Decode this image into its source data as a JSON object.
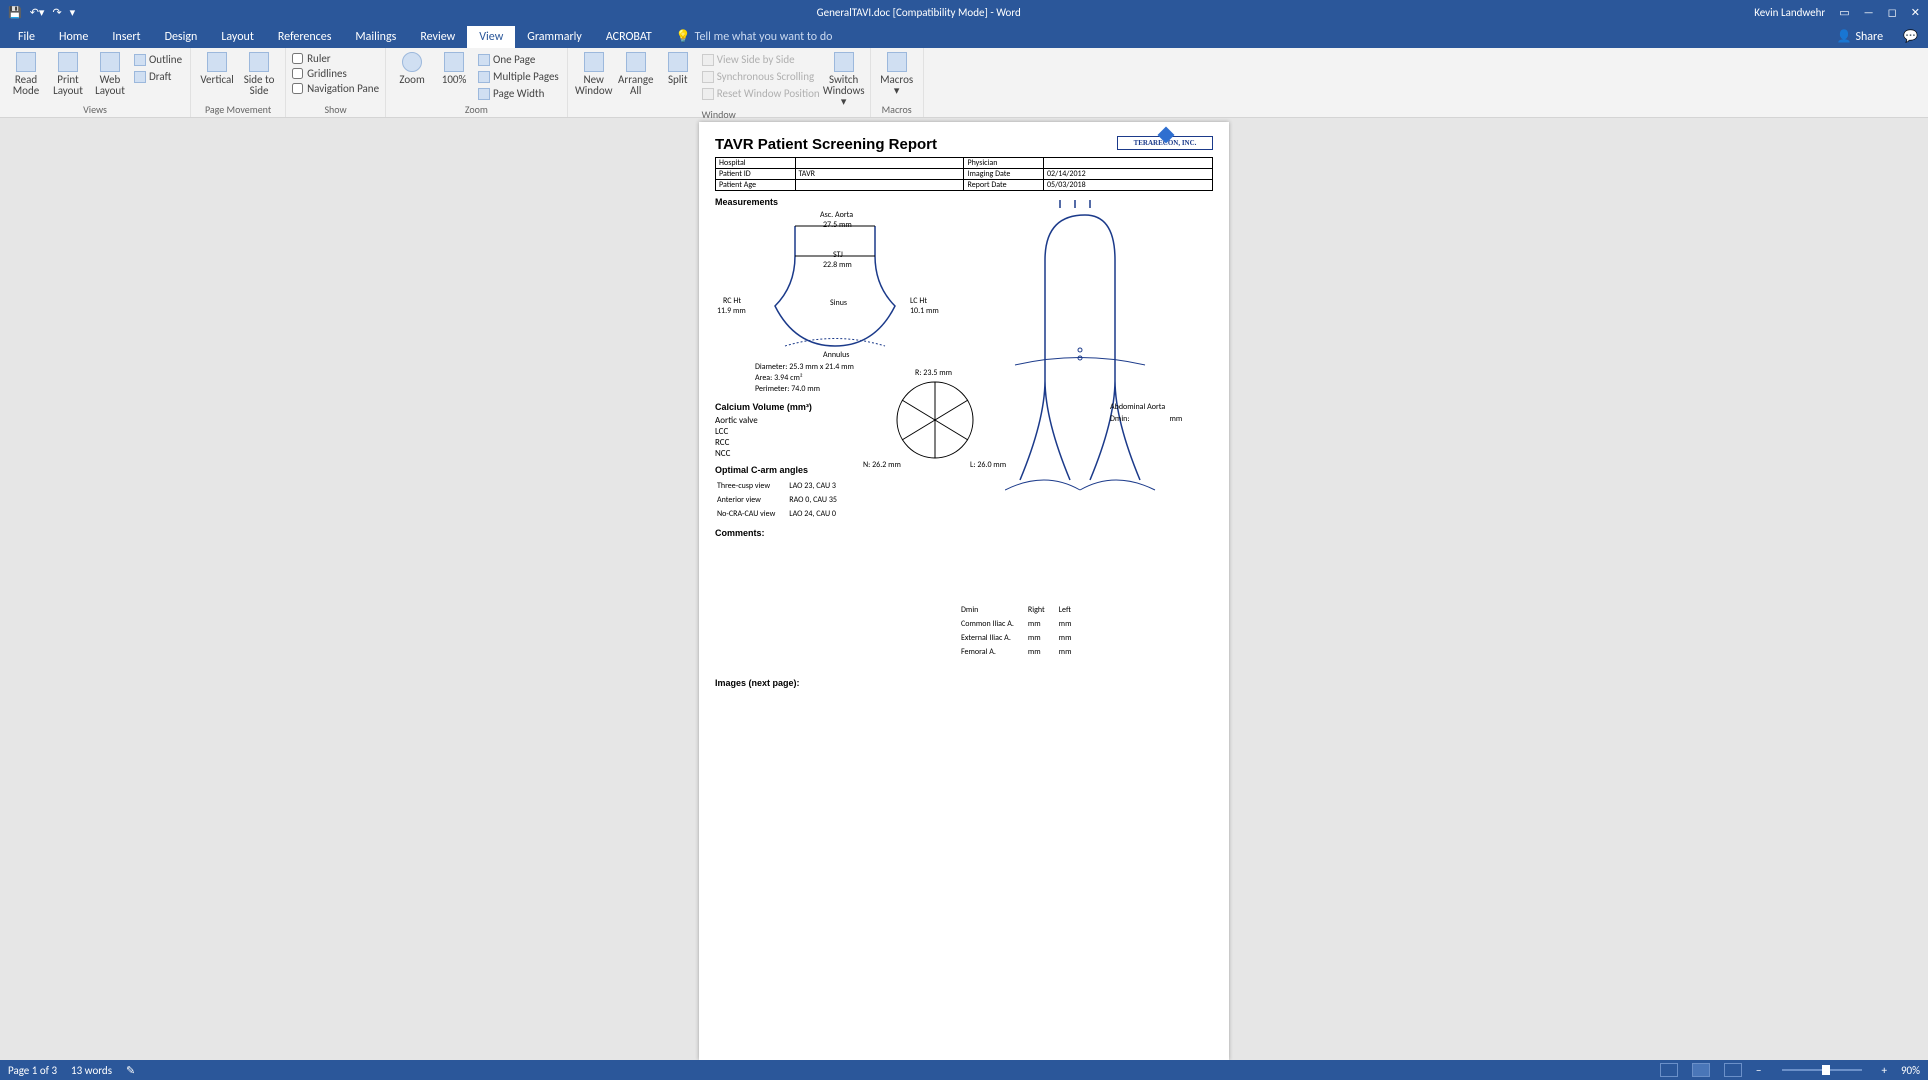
{
  "titlebar": {
    "doc_title": "GeneralTAVI.doc [Compatibility Mode] - Word",
    "user": "Kevin Landwehr"
  },
  "tabs": {
    "file": "File",
    "home": "Home",
    "insert": "Insert",
    "design": "Design",
    "layout": "Layout",
    "references": "References",
    "mailings": "Mailings",
    "review": "Review",
    "view": "View",
    "grammarly": "Grammarly",
    "acrobat": "ACROBAT",
    "tellme": "Tell me what you want to do",
    "share": "Share"
  },
  "ribbon": {
    "views": {
      "read": "Read Mode",
      "print": "Print Layout",
      "web": "Web Layout",
      "outline": "Outline",
      "draft": "Draft",
      "label": "Views"
    },
    "pagemove": {
      "vertical": "Vertical",
      "side": "Side to Side",
      "label": "Page Movement"
    },
    "show": {
      "ruler": "Ruler",
      "gridlines": "Gridlines",
      "navpane": "Navigation Pane",
      "label": "Show"
    },
    "zoom": {
      "zoom": "Zoom",
      "pct": "100%",
      "onepage": "One Page",
      "multipage": "Multiple Pages",
      "pagewidth": "Page Width",
      "label": "Zoom"
    },
    "window": {
      "new": "New Window",
      "arrange": "Arrange All",
      "split": "Split",
      "sidebyside": "View Side by Side",
      "sync": "Synchronous Scrolling",
      "reset": "Reset Window Position",
      "switch": "Switch Windows ▾",
      "label": "Window"
    },
    "macros": {
      "macros": "Macros ▾",
      "label": "Macros"
    }
  },
  "doc": {
    "title": "TAVR Patient Screening Report",
    "logo": "TERARECON, INC.",
    "info": {
      "hospital_lbl": "Hospital",
      "hospital": "",
      "patientid_lbl": "Patient ID",
      "patientid": "TAVR",
      "patientage_lbl": "Patient Age",
      "patientage": "",
      "physician_lbl": "Physician",
      "physician": "",
      "imaging_lbl": "Imaging Date",
      "imaging": "02/14/2012",
      "report_lbl": "Report Date",
      "report": "05/03/2018"
    },
    "measurements_hdr": "Measurements",
    "asc_aorta_lbl": "Asc. Aorta",
    "asc_aorta_val": "27.5   mm",
    "stj_lbl": "STJ",
    "stj_val": "22.8   mm",
    "sinus_lbl": "Sinus",
    "rc_ht_lbl": "RC Ht",
    "rc_ht_val": "11.9 mm",
    "lc_ht_lbl": "LC Ht",
    "lc_ht_val": "10.1  mm",
    "annulus_lbl": "Annulus",
    "diameter_lbl": "Diameter:",
    "diameter_val": "25.3  mm x 21.4  mm",
    "area_lbl": "Area:",
    "area_val": "3.94  cm²",
    "perimeter_lbl": "Perimeter:",
    "perimeter_val": "74.0  mm",
    "calcvol_hdr": "Calcium Volume (mm³)",
    "aortic_valve": "Aortic valve",
    "lcc": "LCC",
    "rcc": "RCC",
    "ncc": "NCC",
    "carm_hdr": "Optimal C-arm angles",
    "threecusp_lbl": "Three-cusp view",
    "threecusp_val": "LAO 23, CAU 3",
    "anterior_lbl": "Anterior view",
    "anterior_val": "RAO 0, CAU 35",
    "nocracau_lbl": "No-CRA-CAU view",
    "nocracau_val": "LAO 24, CAU 0",
    "comments_hdr": "Comments:",
    "r_val": "R: 23.5 mm",
    "n_val": "N: 26.2 mm",
    "l_val": "L: 26.0 mm",
    "abd_aorta_lbl": "Abdominal Aorta",
    "dmin_lbl": "Dmin:",
    "mm": "mm",
    "vessel_dmin": "Dmin",
    "right": "Right",
    "left": "Left",
    "common_iliac": "Common Iliac A.",
    "external_iliac": "External Iliac A.",
    "femoral": "Femoral A.",
    "images_hdr": "Images (next page):"
  },
  "status": {
    "page": "Page 1 of 3",
    "words": "13 words",
    "zoom": "90%"
  }
}
